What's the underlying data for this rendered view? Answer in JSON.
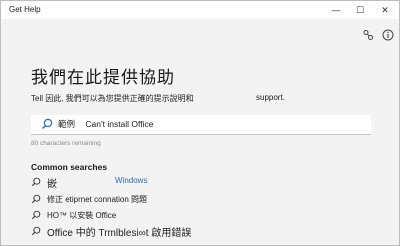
{
  "window": {
    "title": "Get Help",
    "minimize_glyph": "—",
    "maximize_glyph": "☐",
    "close_glyph": "✕"
  },
  "toolbar": {
    "connect_icon": "people-connect-icon",
    "info_icon": "info-icon"
  },
  "main": {
    "heading": "我們在此提供協助",
    "subtitle": "Tell 因此, 我們可以為您提供正確的提示說明和",
    "subtitle_support": "support.",
    "search": {
      "label": "範例",
      "value": "Can't install Office",
      "char_count": "80 characters remaining"
    }
  },
  "common_searches": {
    "title": "Common searches",
    "items": [
      {
        "label": "嵌",
        "extra": "Windows"
      },
      {
        "label": "修正 etiprnet connation 問題"
      },
      {
        "label": "HO™ 以安裝 Office"
      },
      {
        "label": "Office 中的 Trmlblesi∞t 啟用錯誤"
      }
    ]
  },
  "colors": {
    "background": "#f3f3f3",
    "titlebar": "#ffffff",
    "link": "#2b6cb0"
  }
}
